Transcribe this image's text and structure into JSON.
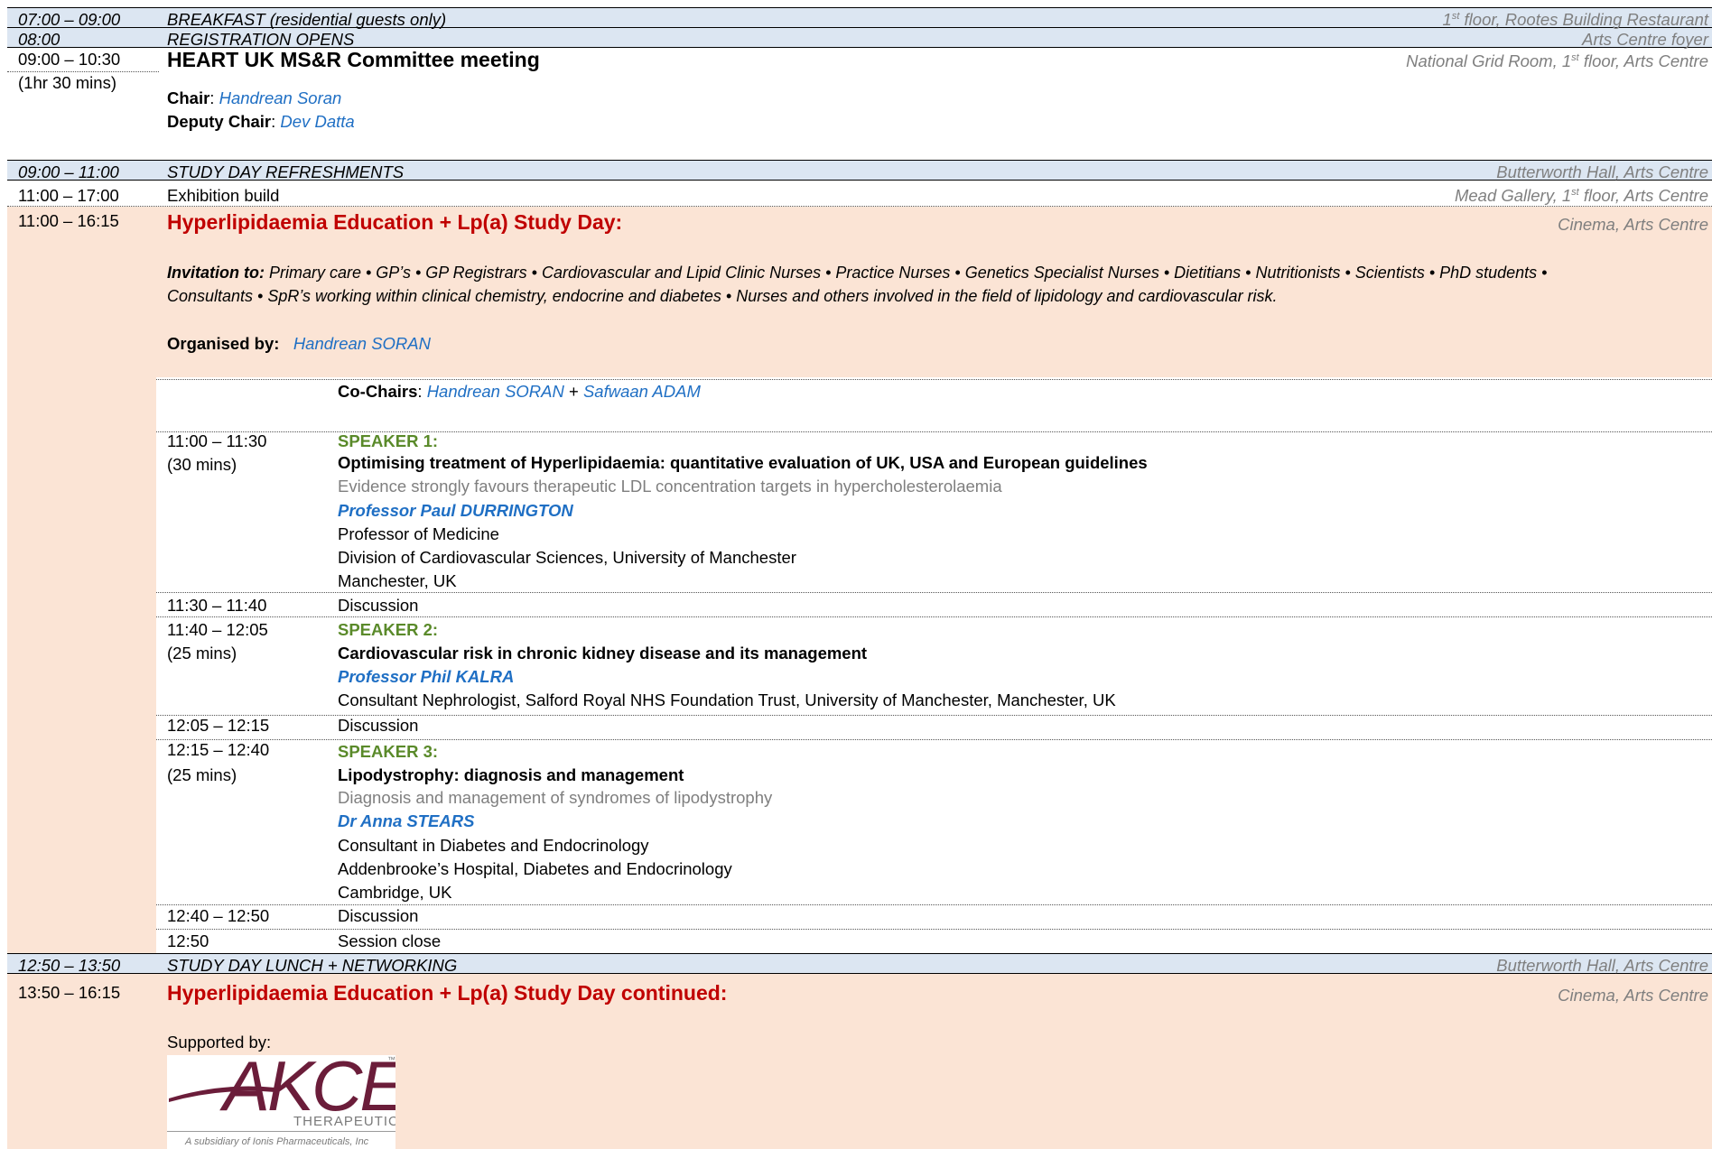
{
  "rows": {
    "breakfast": {
      "time": "07:00 – 09:00",
      "title": "BREAKFAST (residential guests only)",
      "loc_pre": "1",
      "loc_sup": "st",
      "loc_post": " floor, Rootes Building Restaurant"
    },
    "registration": {
      "time": "08:00",
      "title": "REGISTRATION OPENS",
      "loc": "Arts Centre foyer"
    },
    "committee": {
      "time": "09:00 – 10:30",
      "duration": "(1hr 30 mins)",
      "title": "HEART UK MS&R Committee meeting",
      "loc_pre": "National Grid Room, 1",
      "loc_sup": "st",
      "loc_post": " floor, Arts Centre",
      "chair_label": "Chair",
      "chair_name": "Handrean Soran",
      "deputy_label": "Deputy Chair",
      "deputy_name": "Dev Datta"
    },
    "refreshments": {
      "time": "09:00 – 11:00",
      "title": "STUDY DAY REFRESHMENTS",
      "loc": "Butterworth Hall, Arts Centre"
    },
    "exhibition": {
      "time": "11:00 – 17:00",
      "title": "Exhibition build",
      "loc_pre": "Mead Gallery, 1",
      "loc_sup": "st",
      "loc_post": " floor, Arts Centre"
    },
    "studyday": {
      "time": "11:00 – 16:15",
      "title": "Hyperlipidaemia Education + Lp(a) Study Day:",
      "loc": "Cinema, Arts Centre",
      "invitation_label": "Invitation to:",
      "invitation_line1": " Primary care • GP’s • GP Registrars • Cardiovascular and Lipid Clinic Nurses • Practice Nurses • Genetics Specialist Nurses • Dietitians • Nutritionists • Scientists • PhD students •",
      "invitation_line2": "Consultants • SpR’s working within clinical chemistry, endocrine and diabetes • Nurses and others involved in the field of lipidology and cardiovascular risk.",
      "organised_label": "Organised by:",
      "organised_name": "Handrean SORAN",
      "cochairs_label": "Co-Chairs",
      "cochair1": "Handrean SORAN",
      "cochair_plus": " + ",
      "cochair2": "Safwaan ADAM"
    },
    "lunch": {
      "time": "12:50 – 13:50",
      "title": "STUDY DAY LUNCH + NETWORKING",
      "loc": "Butterworth Hall, Arts Centre"
    },
    "continued": {
      "time": "13:50 – 16:15",
      "title": "Hyperlipidaemia Education + Lp(a) Study Day continued:",
      "loc": "Cinema, Arts Centre",
      "supported": "Supported by:"
    }
  },
  "sessions": {
    "s1": {
      "time": "11:00 – 11:30",
      "duration": "(30 mins)",
      "label": "SPEAKER 1:",
      "title": "Optimising treatment of Hyperlipidaemia: quantitative evaluation of UK, USA and European guidelines",
      "subtitle": "Evidence strongly favours therapeutic LDL concentration targets in hypercholesterolaemia",
      "speaker": "Professor Paul DURRINGTON",
      "aff1": "Professor of Medicine",
      "aff2": "Division of Cardiovascular Sciences, University of Manchester",
      "aff3": "Manchester, UK"
    },
    "d1": {
      "time": "11:30 – 11:40",
      "text": "Discussion"
    },
    "s2": {
      "time": "11:40 – 12:05",
      "duration": "(25 mins)",
      "label": "SPEAKER 2:",
      "title": "Cardiovascular risk in chronic kidney disease and its management",
      "speaker": "Professor Phil KALRA",
      "aff1": "Consultant Nephrologist, Salford Royal NHS Foundation Trust, University of Manchester, Manchester, UK"
    },
    "d2": {
      "time": "12:05 – 12:15",
      "text": "Discussion"
    },
    "s3": {
      "time": "12:15 – 12:40",
      "duration": "(25 mins)",
      "label": "SPEAKER 3:",
      "title": "Lipodystrophy: diagnosis and management",
      "subtitle": "Diagnosis and management of syndromes of lipodystrophy",
      "speaker": "Dr Anna STEARS",
      "aff1": "Consultant in Diabetes and Endocrinology",
      "aff2": "Addenbrooke’s Hospital, Diabetes and Endocrinology",
      "aff3": "Cambridge, UK"
    },
    "d3": {
      "time": "12:40 – 12:50",
      "text": "Discussion"
    },
    "close": {
      "time": "12:50",
      "text": "Session close"
    }
  },
  "logo": {
    "brand": "AKCEA",
    "tm": "™",
    "sub": "THERAPEUTICS",
    "tagline": "A subsidiary of Ionis Pharmaceuticals, Inc",
    "brand_color": "#6b1d3a",
    "text_color": "#7a7a7a"
  },
  "colors": {
    "header_band": "#dce6f2",
    "session_band": "#fbe4d5",
    "title_red": "#c00000",
    "link_blue": "#1f6fc4",
    "speaker_green": "#5a8a2a"
  }
}
